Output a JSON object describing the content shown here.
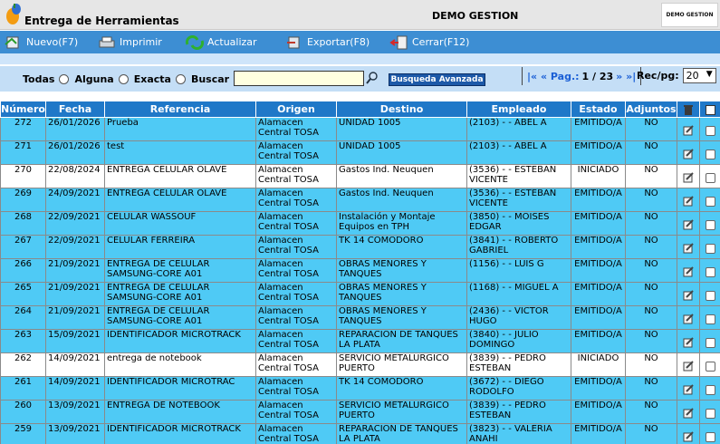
{
  "app": {
    "title": "Entrega de Herramientas",
    "company": "DEMO GESTION",
    "logo_text": "DEMO GESTION"
  },
  "toolbar": {
    "nuevo": "Nuevo(F7)",
    "imprimir": "Imprimir",
    "actualizar": "Actualizar",
    "exportar": "Exportar(F8)",
    "cerrar": "Cerrar(F12)"
  },
  "search": {
    "todas": "Todas",
    "alguna": "Alguna",
    "exacta": "Exacta",
    "buscar": "Buscar",
    "value": "",
    "advanced": "Busqueda Avanzada"
  },
  "pager": {
    "nav_left": "|« « Pag.:",
    "page": "1 / 23",
    "nav_right": "» »|",
    "recpg_label": "Rec/pg:",
    "recpg_value": "20"
  },
  "table": {
    "headers": [
      "Número",
      "Fecha",
      "Referencia",
      "Origen",
      "Destino",
      "Empleado",
      "Estado",
      "Adjuntos"
    ],
    "rows": [
      {
        "numero": "272",
        "fecha": "26/01/2026",
        "referencia": "Prueba",
        "origen": "Alamacen Central TOSA",
        "destino": "UNIDAD 1005",
        "empleado": "(2103) - - ABEL A",
        "estado": "EMITIDO/A",
        "adjuntos": "NO"
      },
      {
        "numero": "271",
        "fecha": "26/01/2026",
        "referencia": "test",
        "origen": "Alamacen Central TOSA",
        "destino": "UNIDAD 1005",
        "empleado": "(2103) - - ABEL A",
        "estado": "EMITIDO/A",
        "adjuntos": "NO"
      },
      {
        "numero": "270",
        "fecha": "22/08/2024",
        "referencia": "ENTREGA CELULAR OLAVE",
        "origen": "Alamacen Central TOSA",
        "destino": "Gastos Ind. Neuquen",
        "empleado": "(3536) - - ESTEBAN VICENTE",
        "estado": "INICIADO",
        "adjuntos": "NO"
      },
      {
        "numero": "269",
        "fecha": "24/09/2021",
        "referencia": "ENTREGA CELULAR OLAVE",
        "origen": "Alamacen Central TOSA",
        "destino": "Gastos Ind. Neuquen",
        "empleado": "(3536) - - ESTEBAN VICENTE",
        "estado": "EMITIDO/A",
        "adjuntos": "NO"
      },
      {
        "numero": "268",
        "fecha": "22/09/2021",
        "referencia": "CELULAR WASSOUF",
        "origen": "Alamacen Central TOSA",
        "destino": "Instalación y Montaje Equipos en TPH",
        "empleado": "(3850) - - MOISES EDGAR",
        "estado": "EMITIDO/A",
        "adjuntos": "NO"
      },
      {
        "numero": "267",
        "fecha": "22/09/2021",
        "referencia": "CELULAR FERREIRA",
        "origen": "Alamacen Central TOSA",
        "destino": "TK 14 COMODORO",
        "empleado": "(3841) - - ROBERTO GABRIEL",
        "estado": "EMITIDO/A",
        "adjuntos": "NO"
      },
      {
        "numero": "266",
        "fecha": "21/09/2021",
        "referencia": "ENTREGA DE CELULAR SAMSUNG-CORE A01",
        "origen": "Alamacen Central TOSA",
        "destino": "OBRAS MENORES Y TANQUES",
        "empleado": "(1156) - - LUIS G",
        "estado": "EMITIDO/A",
        "adjuntos": "NO"
      },
      {
        "numero": "265",
        "fecha": "21/09/2021",
        "referencia": "ENTREGA DE CELULAR SAMSUNG-CORE A01",
        "origen": "Alamacen Central TOSA",
        "destino": "OBRAS MENORES Y TANQUES",
        "empleado": "(1168) - - MIGUEL A",
        "estado": "EMITIDO/A",
        "adjuntos": "NO"
      },
      {
        "numero": "264",
        "fecha": "21/09/2021",
        "referencia": "ENTREGA DE CELULAR SAMSUNG-CORE A01",
        "origen": "Alamacen Central TOSA",
        "destino": "OBRAS MENORES Y TANQUES",
        "empleado": "(2436) - - VICTOR HUGO",
        "estado": "EMITIDO/A",
        "adjuntos": "NO"
      },
      {
        "numero": "263",
        "fecha": "15/09/2021",
        "referencia": "IDENTIFICADOR MICROTRACK",
        "origen": "Alamacen Central TOSA",
        "destino": "REPARACION DE TANQUES LA PLATA",
        "empleado": "(3840) - - JULIO DOMINGO",
        "estado": "EMITIDO/A",
        "adjuntos": "NO"
      },
      {
        "numero": "262",
        "fecha": "14/09/2021",
        "referencia": "entrega de notebook",
        "origen": "Alamacen Central TOSA",
        "destino": "SERVICIO METALURGICO PUERTO",
        "empleado": "(3839) - - PEDRO ESTEBAN",
        "estado": "INICIADO",
        "adjuntos": "NO"
      },
      {
        "numero": "261",
        "fecha": "14/09/2021",
        "referencia": "IDENTIFICADOR MICROTRAC",
        "origen": "Alamacen Central TOSA",
        "destino": "TK 14 COMODORO",
        "empleado": "(3672) - - DIEGO RODOLFO",
        "estado": "EMITIDO/A",
        "adjuntos": "NO"
      },
      {
        "numero": "260",
        "fecha": "13/09/2021",
        "referencia": "ENTREGA DE NOTEBOOK",
        "origen": "Alamacen Central TOSA",
        "destino": "SERVICIO METALURGICO PUERTO",
        "empleado": "(3839) - - PEDRO ESTEBAN",
        "estado": "EMITIDO/A",
        "adjuntos": "NO"
      },
      {
        "numero": "259",
        "fecha": "13/09/2021",
        "referencia": "IDENTIFICADOR MICROTRACK",
        "origen": "Alamacen Central TOSA",
        "destino": "REPARACION DE TANQUES LA PLATA",
        "empleado": "(3823) - - VALERIA ANAHI",
        "estado": "EMITIDO/A",
        "adjuntos": "NO"
      }
    ]
  },
  "colors": {
    "toolbar": "#3d8ed3",
    "header": "#1f78c8",
    "row_emitido": "#4fcaf5",
    "row_iniciado": "#ffffff"
  }
}
